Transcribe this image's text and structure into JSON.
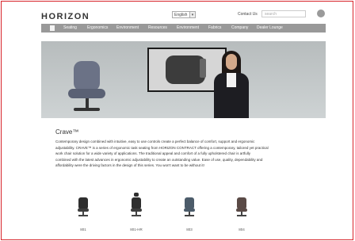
{
  "header": {
    "logo_text": "HORIZON",
    "language": "English",
    "contact_label": "Contact Us",
    "search_placeholder": "search"
  },
  "nav": {
    "items": [
      "Seating",
      "Ergonomics",
      "Environment",
      "Resources",
      "Environment",
      "Fabrics",
      "Company",
      "Dealer Lounge"
    ]
  },
  "intro": {
    "title": "Crave™",
    "paragraphs": [
      "Contemporary design combined with intuitive, easy to use controls create a perfect balance of comfort, support and ergonomic",
      "adjustability. CRAVE™ is a series of ergonomic task seating from HORIZON CONTRACT offering a contemporary, tailored yet practical",
      "work chair solution for a wide variety of applications. The traditional appeal and comfort of a fully upholstered chair is artfully",
      "combined with the latest advances in ergonomic adjustability to create an outstanding value. Ease of use, quality, dependability and",
      "affordability were the driving factors in the design of this series. You won't want to be without it!"
    ]
  },
  "chairs": [
    {
      "label": "801"
    },
    {
      "label": "801-HR"
    },
    {
      "label": "803"
    },
    {
      "label": "804"
    }
  ],
  "colors": {
    "frame_border": "#d8232a",
    "nav_background": "#999999"
  }
}
